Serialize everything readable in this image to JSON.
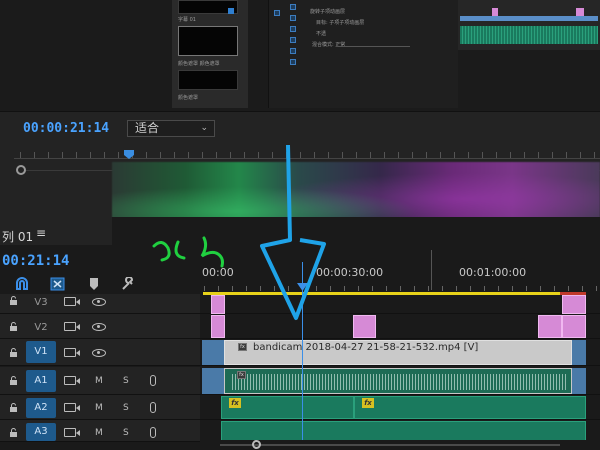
{
  "monitor": {
    "timecode": "00:00:21:14",
    "fit_label": "适合",
    "thumbs": [
      {
        "label": "字幕 01"
      },
      {
        "label": "颜色遮罩 颜色遮罩"
      },
      {
        "label": "颜色遮罩"
      }
    ],
    "effect_controls": {
      "rows": [
        "旋转子项动画层",
        "目标: 子项子项动画层",
        "不透",
        "混合模式: 正常"
      ],
      "dropdown": "正常"
    }
  },
  "timeline": {
    "sequence_title": "列 01",
    "menu_icon": "hamburger-icon",
    "timecode": "00:21:14",
    "ruler_labels": [
      "00:00",
      "00:00:30:00",
      "00:01:00:00"
    ],
    "tracks": [
      {
        "name": "V3",
        "type": "video"
      },
      {
        "name": "V2",
        "type": "video"
      },
      {
        "name": "V1",
        "type": "video"
      },
      {
        "name": "A1",
        "type": "audio",
        "m": "M",
        "s": "S"
      },
      {
        "name": "A2",
        "type": "audio",
        "m": "M",
        "s": "S"
      },
      {
        "name": "A3",
        "type": "audio",
        "m": "M",
        "s": "S"
      }
    ],
    "clip_name": "bandicam 2018-04-27 21-58-21-532.mp4 [V]",
    "fx_label": "fx"
  },
  "colors": {
    "accent": "#4aa3ff",
    "clip_pink": "#d68ad6",
    "clip_audio": "#1a7a5e",
    "work_area": "#e8d21a",
    "annotation_arrow": "#1fa3e8",
    "annotation_scribble": "#20d040"
  }
}
